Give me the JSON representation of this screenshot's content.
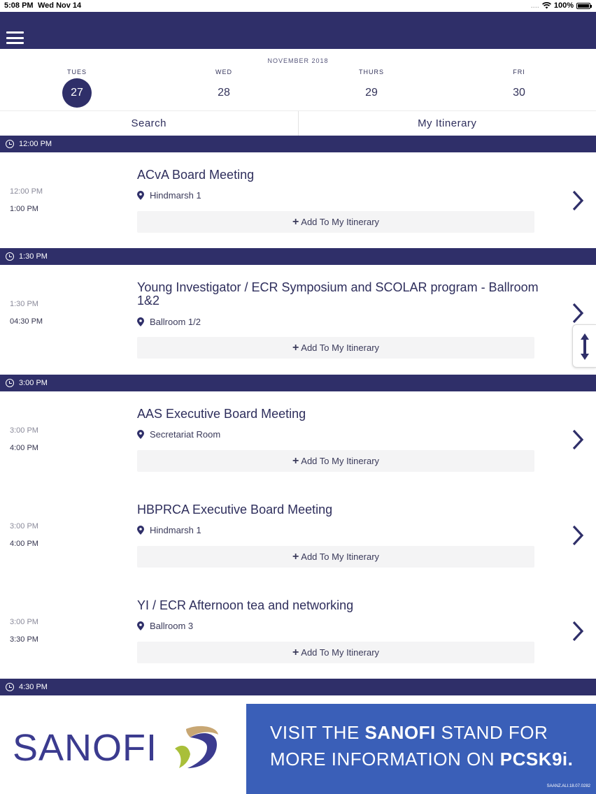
{
  "status_bar": {
    "time": "5:08 PM",
    "date": "Wed Nov 14",
    "signal": "....",
    "battery": "100%"
  },
  "calendar": {
    "month": "NOVEMBER 2018",
    "days": [
      {
        "name": "TUES",
        "number": "27",
        "selected": true
      },
      {
        "name": "WED",
        "number": "28",
        "selected": false
      },
      {
        "name": "THURS",
        "number": "29",
        "selected": false
      },
      {
        "name": "FRI",
        "number": "30",
        "selected": false
      }
    ]
  },
  "tabs": {
    "search": "Search",
    "itinerary": "My Itinerary"
  },
  "time_slots": [
    "12:00 PM",
    "1:30 PM",
    "3:00 PM",
    "4:30 PM"
  ],
  "sessions": [
    {
      "title": "ACvA Board Meeting",
      "location": "Hindmarsh 1",
      "start": "12:00 PM",
      "end": "1:00 PM",
      "action": "Add To My Itinerary"
    },
    {
      "title": "Young Investigator / ECR Symposium and SCOLAR program - Ballroom 1&2",
      "location": "Ballroom 1/2",
      "start": "1:30 PM",
      "end": "04:30 PM",
      "action": "Add To My Itinerary"
    },
    {
      "title": "AAS Executive Board Meeting",
      "location": "Secretariat Room",
      "start": "3:00 PM",
      "end": "4:00 PM",
      "action": "Add To My Itinerary"
    },
    {
      "title": "HBPRCA Executive Board Meeting",
      "location": "Hindmarsh 1",
      "start": "3:00 PM",
      "end": "4:00 PM",
      "action": "Add To My Itinerary"
    },
    {
      "title": "YI / ECR Afternoon tea and networking",
      "location": "Ballroom 3",
      "start": "3:00 PM",
      "end": "3:30 PM",
      "action": "Add To My Itinerary"
    }
  ],
  "banner": {
    "logo_text": "SANOFI",
    "line1_a": "VISIT THE ",
    "line1_b": "SANOFI",
    "line1_c": " STAND FOR",
    "line2_a": "MORE INFORMATION ON ",
    "line2_b": "PCSK9i.",
    "fine_print": "SAANZ.ALI.18.07.0282"
  },
  "colors": {
    "navy": "#2f2f69",
    "banner_blue": "#3a5fb8"
  },
  "icons": [
    "menu-icon",
    "clock-icon",
    "location-pin-icon",
    "plus-icon",
    "chevron-right-icon",
    "resize-vertical-icon",
    "wifi-icon",
    "battery-icon"
  ]
}
